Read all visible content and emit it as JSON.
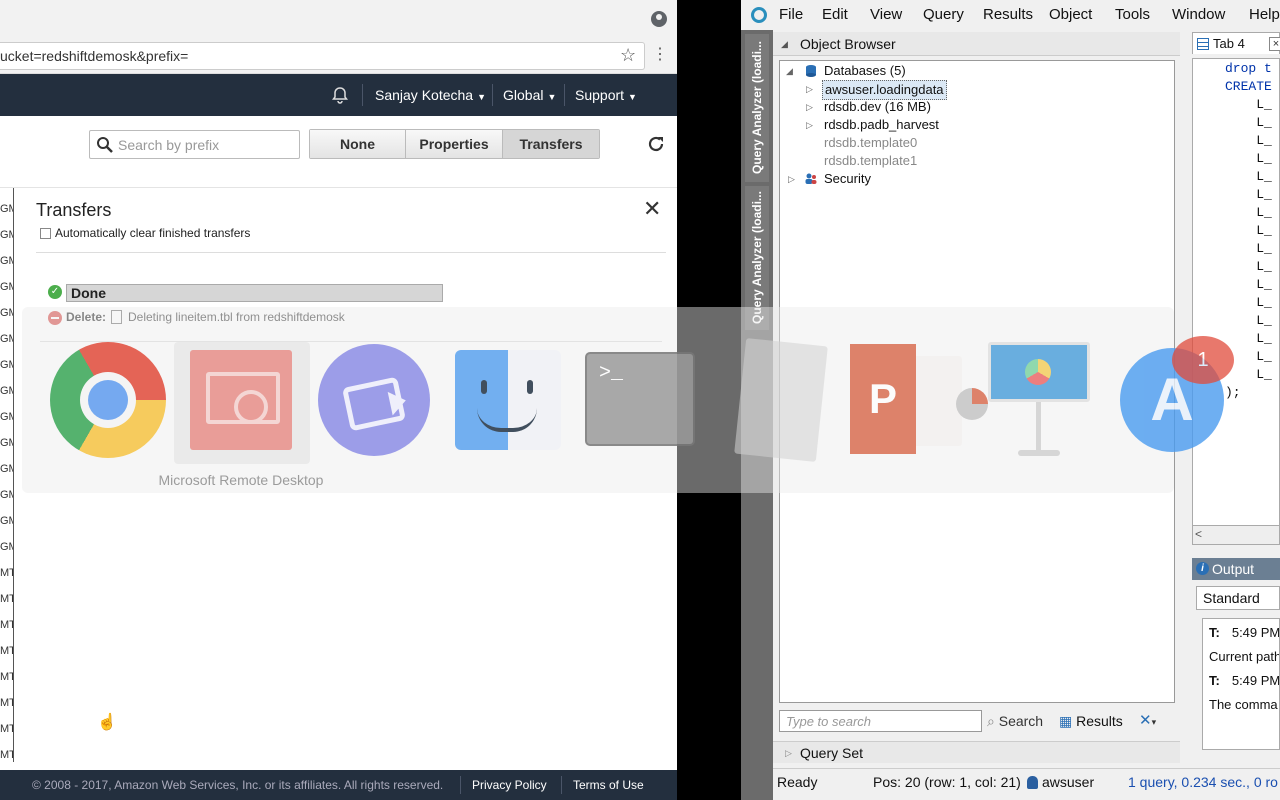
{
  "browser": {
    "url": "ucket=redshiftdemosk&prefix=",
    "nav": {
      "user": "Sanjay Kotecha",
      "region": "Global",
      "support": "Support"
    },
    "toolbar": {
      "search_placeholder": "Search by prefix",
      "view_buttons": [
        "None",
        "Properties",
        "Transfers"
      ],
      "active_view": "Transfers"
    },
    "filelist_edge": [
      "GM",
      "GM",
      "GM",
      "GM",
      "GM",
      "GM",
      "GM",
      "GM",
      "GM",
      "GM",
      "GM",
      "GM",
      "GM",
      "GM",
      "MT",
      "MT",
      "MT",
      "MT",
      "MT",
      "MT",
      "MT",
      "MT",
      "MT",
      "MT",
      "GM"
    ],
    "transfers": {
      "title": "Transfers",
      "auto_clear_label": "Automatically clear finished transfers",
      "auto_clear_checked": false,
      "status_label": "Done",
      "progress_fraction": 1.0,
      "item_action": "Delete:",
      "item_text": "Deleting lineitem.tbl from redshiftdemosk"
    },
    "footer": {
      "copyright": "© 2008 - 2017, Amazon Web Services, Inc. or its affiliates. All rights reserved.",
      "privacy": "Privacy Policy",
      "terms": "Terms of Use"
    }
  },
  "dock": {
    "rdp_label": "Microsoft Remote Desktop",
    "terminal_prompt": ">_",
    "ppt_letter": "P",
    "store_letter": "A",
    "store_badge": "1",
    "apps": [
      "chrome-icon",
      "remote-desktop-icon",
      "video-app-icon",
      "finder-icon",
      "terminal-icon",
      "textedit-icon",
      "powerpoint-icon",
      "keynote-icon",
      "app-store-icon"
    ]
  },
  "query_analyzer": {
    "menu": [
      "File",
      "Edit",
      "View",
      "Query",
      "Results",
      "Object",
      "Tools",
      "Window",
      "Help"
    ],
    "side_tabs": [
      "Query Analyzer (loadi...",
      "Query Analyzer (loadi..."
    ],
    "object_browser": {
      "title": "Object Browser",
      "tree": [
        {
          "label": "Databases (5)",
          "level": 0,
          "expanded": true,
          "icon": "database-icon"
        },
        {
          "label": "awsuser.loadingdata",
          "level": 1,
          "selected": true
        },
        {
          "label": "rdsdb.dev (16 MB)",
          "level": 1
        },
        {
          "label": "rdsdb.padb_harvest",
          "level": 1
        },
        {
          "label": "rdsdb.template0",
          "level": 1,
          "dim": true
        },
        {
          "label": "rdsdb.template1",
          "level": 1,
          "dim": true
        },
        {
          "label": "Security",
          "level": 0,
          "icon": "users-icon"
        }
      ]
    },
    "search": {
      "placeholder": "Type to search",
      "search_label": "Search",
      "results_label": "Results"
    },
    "query_set_label": "Query Set",
    "editor": {
      "tab_label": "Tab 4",
      "close_glyph": "×",
      "code_lines": [
        "drop t",
        "CREATE",
        "    L_",
        "    L_",
        "    L_",
        "    L_",
        "    L_",
        "    L_",
        "    L_",
        "    L_",
        "    L_",
        "    L_",
        "    L_",
        "    L_",
        "    L_",
        "    L_",
        "    L_",
        "    L_",
        ");"
      ]
    },
    "output": {
      "title": "Output",
      "standard_tab": "Standard",
      "rows": [
        {
          "tag": "T:",
          "text": "5:49 PM"
        },
        {
          "tag": "",
          "text": "Current path"
        },
        {
          "tag": "T:",
          "text": "5:49 PM"
        },
        {
          "tag": "",
          "text": "The comma"
        }
      ]
    },
    "status": {
      "state": "Ready",
      "position": "Pos: 20 (row: 1, col: 21)",
      "user": "awsuser",
      "stats": "1 query, 0.234 sec., 0 ro"
    }
  }
}
